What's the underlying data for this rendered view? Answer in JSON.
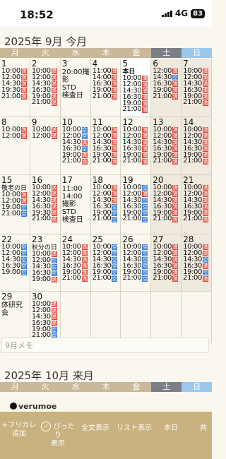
{
  "status_bar": {
    "time": "18:52",
    "network": "4G",
    "battery": "83"
  },
  "month1": {
    "title": "2025年 9月 今月",
    "memo_placeholder": "9月メモ"
  },
  "month2": {
    "title": "2025年 10月 来月"
  },
  "weekdays": [
    "月",
    "火",
    "水",
    "木",
    "金",
    "土",
    "日"
  ],
  "tags": {
    "red": "満",
    "blue": "空"
  },
  "logo": "verumoe",
  "toolbar": {
    "add_label": "+フリカレ\n追加",
    "fit_label": "ぴったり\n表示",
    "fulltext_label": "全文表示",
    "list_label": "リスト表示",
    "today_label": "本日",
    "share_label": "共"
  },
  "weeks": [
    [
      {
        "day": "1",
        "slots": [
          [
            "10:00",
            "r"
          ],
          [
            "12:00",
            "r"
          ],
          [
            "14:30",
            "r"
          ],
          [
            "19:30",
            "r"
          ],
          [
            "21:00",
            "r"
          ]
        ]
      },
      {
        "day": "2",
        "slots": [
          [
            "10:00",
            "r"
          ],
          [
            "12:00",
            "r"
          ],
          [
            "14:30",
            "r"
          ],
          [
            "16:30",
            "r"
          ],
          [
            "19:00",
            "r"
          ],
          [
            "21:00",
            "r"
          ]
        ]
      },
      {
        "day": "3",
        "notes": [
          "20:00撮",
          "影",
          "STD",
          "検査日"
        ]
      },
      {
        "day": "4",
        "slots": [
          [
            "11:00",
            "r"
          ],
          [
            "14:00",
            "r"
          ],
          [
            "16:30",
            "r"
          ],
          [
            "19:00",
            "r"
          ],
          [
            "21:00",
            "r"
          ]
        ]
      },
      {
        "day": "5",
        "today": true,
        "label": "本日",
        "slots": [
          [
            "10:00",
            "r"
          ],
          [
            "12:00",
            "r"
          ],
          [
            "14:30",
            "r"
          ],
          [
            "16:30",
            "r"
          ],
          [
            "19:00",
            "r"
          ],
          [
            "21:00",
            "r"
          ]
        ]
      },
      {
        "day": "6",
        "weekend": "sat",
        "slots": [
          [
            "12:00",
            "r"
          ],
          [
            "14:30",
            "b"
          ],
          [
            "16:30",
            "r"
          ],
          [
            "19:00",
            "r"
          ],
          [
            "21:00",
            "r"
          ]
        ]
      },
      {
        "day": "7",
        "weekend": "sun",
        "slots": [
          [
            "10:00",
            "r"
          ],
          [
            "12:00",
            "r"
          ],
          [
            "14:30",
            "r"
          ],
          [
            "16:30",
            "r"
          ],
          [
            "19:00",
            "r"
          ],
          [
            "21:00",
            "r"
          ]
        ]
      }
    ],
    [
      {
        "day": "8",
        "slots": [
          [
            "10:00",
            "r"
          ],
          [
            "12:00",
            "r"
          ]
        ]
      },
      {
        "day": "9",
        "slots": [
          [
            "10:00",
            "r"
          ],
          [
            "12:00",
            "r"
          ]
        ]
      },
      {
        "day": "10",
        "slots": [
          [
            "10:00",
            "b"
          ],
          [
            "12:00",
            "b"
          ],
          [
            "14:30",
            "r"
          ],
          [
            "16:30",
            "b"
          ],
          [
            "19:00",
            "r"
          ],
          [
            "21:00",
            "r"
          ]
        ]
      },
      {
        "day": "11",
        "slots": [
          [
            "10:00",
            "r"
          ],
          [
            "12:00",
            "r"
          ],
          [
            "14:30",
            "r"
          ],
          [
            "16:30",
            "r"
          ],
          [
            "19:00",
            "r"
          ],
          [
            "21:00",
            "r"
          ]
        ]
      },
      {
        "day": "12",
        "slots": [
          [
            "10:00",
            "r"
          ],
          [
            "12:00",
            "r"
          ],
          [
            "14:30",
            "r"
          ],
          [
            "16:30",
            "r"
          ],
          [
            "19:00",
            "r"
          ],
          [
            "21:00",
            "r"
          ]
        ]
      },
      {
        "day": "13",
        "weekend": "sat",
        "slots": [
          [
            "10:00",
            "r"
          ],
          [
            "12:00",
            "r"
          ],
          [
            "14:30",
            "r"
          ],
          [
            "16:30",
            "r"
          ],
          [
            "19:00",
            "r"
          ],
          [
            "21:00",
            "r"
          ]
        ]
      },
      {
        "day": "14",
        "weekend": "sun",
        "slots": [
          [
            "10:00",
            "r"
          ],
          [
            "12:00",
            "r"
          ],
          [
            "14:30",
            "r"
          ],
          [
            "16:30",
            "r"
          ],
          [
            "19:00",
            "r"
          ],
          [
            "21:00",
            "r"
          ]
        ]
      }
    ],
    [
      {
        "day": "15",
        "holiday": "敬老の日",
        "slots": [
          [
            "10:00",
            "r"
          ],
          [
            "12:00",
            "r"
          ],
          [
            "19:00",
            "b"
          ],
          [
            "21:00",
            "b"
          ]
        ]
      },
      {
        "day": "16",
        "slots": [
          [
            "10:00",
            "r"
          ],
          [
            "12:00",
            "r"
          ],
          [
            "14:30",
            "r"
          ],
          [
            "16:30",
            "r"
          ],
          [
            "19:30",
            "r"
          ],
          [
            "21:00",
            "r"
          ]
        ]
      },
      {
        "day": "17",
        "notes": [
          "11:00",
          "14:00",
          "撮影",
          "STD",
          "検査日"
        ]
      },
      {
        "day": "18",
        "slots": [
          [
            "10:00",
            "r"
          ],
          [
            "12:00",
            "r"
          ],
          [
            "14:30",
            "r"
          ],
          [
            "16:30",
            "b"
          ],
          [
            "19:00",
            "b"
          ],
          [
            "21:00",
            "b"
          ]
        ]
      },
      {
        "day": "19",
        "slots": [
          [
            "10:00",
            "b"
          ],
          [
            "12:00",
            "r"
          ],
          [
            "14:30",
            "b"
          ],
          [
            "16:30",
            "b"
          ],
          [
            "19:00",
            "b"
          ],
          [
            "21:00",
            "b"
          ]
        ]
      },
      {
        "day": "20",
        "weekend": "sat",
        "slots": [
          [
            "10:00",
            "r"
          ],
          [
            "12:00",
            "r"
          ],
          [
            "14:30",
            "r"
          ],
          [
            "16:30",
            "r"
          ],
          [
            "19:00",
            "r"
          ],
          [
            "21:00",
            "r"
          ]
        ]
      },
      {
        "day": "21",
        "weekend": "sun",
        "slots": [
          [
            "10:00",
            "r"
          ],
          [
            "12:00",
            "r"
          ],
          [
            "14:30",
            "r"
          ],
          [
            "16:30",
            "r"
          ],
          [
            "19:00",
            "r"
          ],
          [
            "21:00",
            "r"
          ]
        ]
      }
    ],
    [
      {
        "day": "22",
        "slots": [
          [
            "10:00",
            "b"
          ],
          [
            "12:00",
            "b"
          ],
          [
            "14:30",
            "b"
          ],
          [
            "16:30",
            "b"
          ],
          [
            "19:00",
            "b"
          ]
        ]
      },
      {
        "day": "23",
        "holiday": "秋分の日",
        "slots": [
          [
            "10:00",
            "r"
          ],
          [
            "12:00",
            "b"
          ],
          [
            "14:30",
            "b"
          ],
          [
            "16:30",
            "b"
          ],
          [
            "19:00",
            "r"
          ]
        ]
      },
      {
        "day": "24",
        "slots": [
          [
            "10:00",
            "r"
          ],
          [
            "12:00",
            "r"
          ],
          [
            "14:30",
            "r"
          ],
          [
            "16:30",
            "r"
          ],
          [
            "19:00",
            "r"
          ],
          [
            "21:00",
            "r"
          ]
        ]
      },
      {
        "day": "25",
        "slots": [
          [
            "10:00",
            "b"
          ],
          [
            "12:00",
            "b"
          ],
          [
            "14:30",
            "b"
          ],
          [
            "16:30",
            "b"
          ],
          [
            "19:00",
            "b"
          ],
          [
            "21:00",
            "b"
          ]
        ]
      },
      {
        "day": "26",
        "slots": [
          [
            "10:00",
            "b"
          ],
          [
            "12:00",
            "b"
          ],
          [
            "14:30",
            "b"
          ],
          [
            "16:30",
            "b"
          ],
          [
            "19:00",
            "b"
          ],
          [
            "21:00",
            "b"
          ]
        ]
      },
      {
        "day": "27",
        "weekend": "sat",
        "slots": [
          [
            "10:00",
            "r"
          ],
          [
            "12:00",
            "r"
          ],
          [
            "14:30",
            "r"
          ],
          [
            "16:30",
            "r"
          ],
          [
            "19:00",
            "r"
          ],
          [
            "21:00",
            "r"
          ]
        ]
      },
      {
        "day": "28",
        "weekend": "sun",
        "slots": [
          [
            "10:00",
            "r"
          ],
          [
            "12:00",
            "r"
          ],
          [
            "14:30",
            "b"
          ],
          [
            "16:30",
            "r"
          ],
          [
            "19:00",
            "b"
          ],
          [
            "21:00",
            "r"
          ]
        ]
      }
    ],
    [
      {
        "day": "29",
        "notes": [
          "体研究会"
        ]
      },
      {
        "day": "30",
        "slots": [
          [
            "10:00",
            "r"
          ],
          [
            "12:00",
            "r"
          ],
          [
            "14:30",
            "r"
          ],
          [
            "16:30",
            "r"
          ],
          [
            "19:00",
            "b"
          ],
          [
            "21:00",
            "b"
          ]
        ]
      },
      {
        "empty": true
      },
      {
        "empty": true
      },
      {
        "empty": true
      },
      {
        "empty": true
      },
      {
        "empty": true
      }
    ]
  ]
}
